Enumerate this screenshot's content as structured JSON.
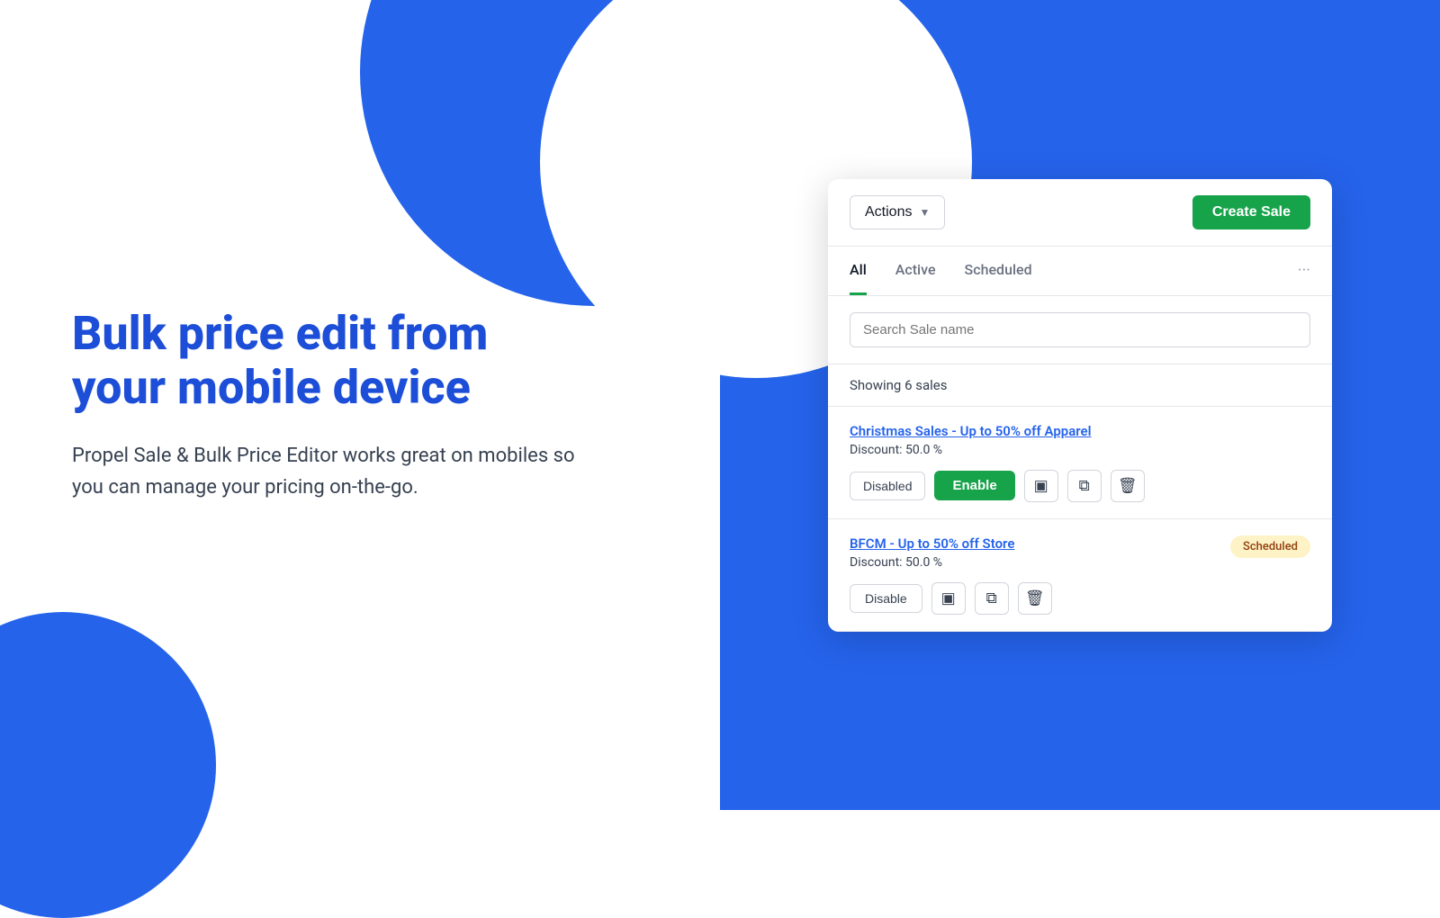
{
  "left": {
    "heading_line1": "Bulk price edit from",
    "heading_line2": "your mobile device",
    "description": "Propel Sale & Bulk Price Editor works great on mobiles so you can manage your pricing on-the-go."
  },
  "app": {
    "topbar": {
      "actions_label": "Actions",
      "create_sale_label": "Create Sale"
    },
    "tabs": [
      {
        "label": "All",
        "active": true
      },
      {
        "label": "Active",
        "active": false
      },
      {
        "label": "Scheduled",
        "active": false
      },
      {
        "label": "···",
        "active": false
      }
    ],
    "search_placeholder": "Search Sale name",
    "showing_text": "Showing 6 sales",
    "sales": [
      {
        "title": "Christmas Sales - Up to 50% off Apparel",
        "discount": "Discount: 50.0 %",
        "status": "Disabled",
        "action_btn": "Enable",
        "action_type": "enable",
        "badge": null
      },
      {
        "title": "BFCM - Up to 50% off Store",
        "discount": "Discount: 50.0 %",
        "status": null,
        "action_btn": "Disable",
        "action_type": "disable",
        "badge": "Scheduled"
      }
    ],
    "icons": {
      "edit": "▣",
      "copy": "⧉",
      "delete": "🗑"
    }
  }
}
